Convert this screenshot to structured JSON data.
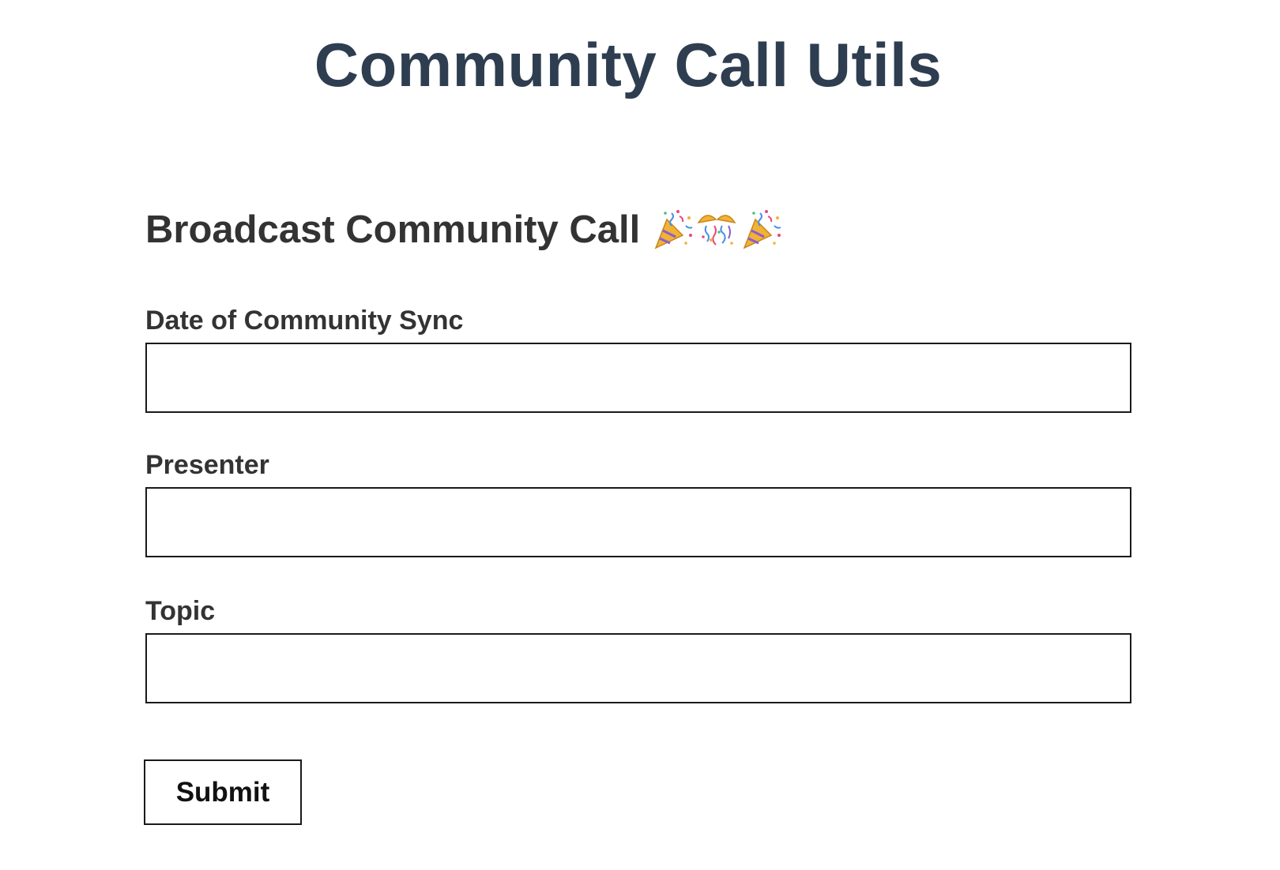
{
  "page": {
    "title": "Community Call Utils"
  },
  "form": {
    "heading": "Broadcast Community Call",
    "heading_icons": [
      "party-popper-icon",
      "confetti-ball-icon",
      "party-popper-icon"
    ],
    "fields": [
      {
        "label": "Date of Community Sync",
        "value": "",
        "placeholder": ""
      },
      {
        "label": "Presenter",
        "value": "",
        "placeholder": ""
      },
      {
        "label": "Topic",
        "value": "",
        "placeholder": ""
      }
    ],
    "submit_label": "Submit"
  },
  "colors": {
    "title": "#2e3e50",
    "text": "#333333",
    "border": "#1a1a1a",
    "background": "#ffffff"
  }
}
